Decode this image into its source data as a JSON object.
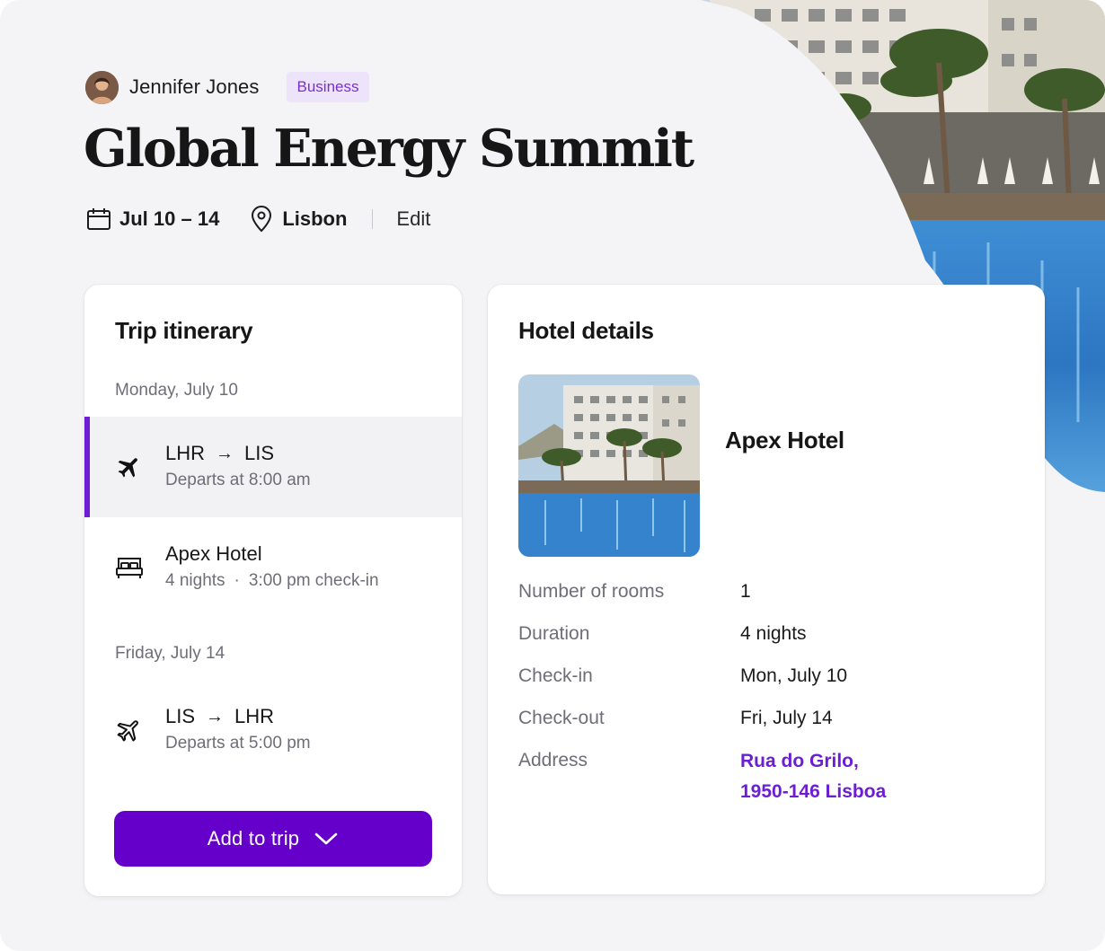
{
  "owner": {
    "name": "Jennifer Jones",
    "badge": "Business"
  },
  "trip": {
    "title": "Global Energy Summit",
    "dates": "Jul 10 – 14",
    "location": "Lisbon",
    "edit_label": "Edit"
  },
  "itinerary": {
    "title": "Trip itinerary",
    "days": [
      {
        "label": "Monday, July 10",
        "items": [
          {
            "kind": "flight-depart",
            "from": "LHR",
            "arrow": "→",
            "to": "LIS",
            "subtitle": "Departs at 8:00 am",
            "active": true
          },
          {
            "kind": "hotel",
            "title": "Apex Hotel",
            "subtitle_a": "4 nights",
            "dot": "·",
            "subtitle_b": "3:00 pm check-in",
            "active": false
          }
        ]
      },
      {
        "label": "Friday, July 14",
        "items": [
          {
            "kind": "flight-return",
            "from": "LIS",
            "arrow": "→",
            "to": "LHR",
            "subtitle": "Departs at 5:00 pm",
            "active": false
          }
        ]
      }
    ],
    "add_button": "Add to trip"
  },
  "hotel": {
    "title": "Hotel details",
    "name": "Apex Hotel",
    "details": [
      {
        "label": "Number of rooms",
        "value": "1"
      },
      {
        "label": "Duration",
        "value": "4 nights"
      },
      {
        "label": "Check-in",
        "value": "Mon, July 10"
      },
      {
        "label": "Check-out",
        "value": "Fri, July 14"
      },
      {
        "label": "Address",
        "value_line1": "Rua do Grilo,",
        "value_line2": "1950-146 Lisboa"
      }
    ]
  },
  "colors": {
    "accent": "#6400c9",
    "accent_text": "#6d1ed4",
    "badge_bg": "#ede4fb",
    "background": "#f4f4f6",
    "muted_text": "#6e6e78"
  },
  "icons": {
    "date": "calendar-icon",
    "location": "map-pin-icon",
    "flight_depart": "airplane-filled-icon",
    "hotel": "bed-icon",
    "flight_return": "airplane-outline-icon",
    "dropdown": "chevron-down-icon"
  }
}
